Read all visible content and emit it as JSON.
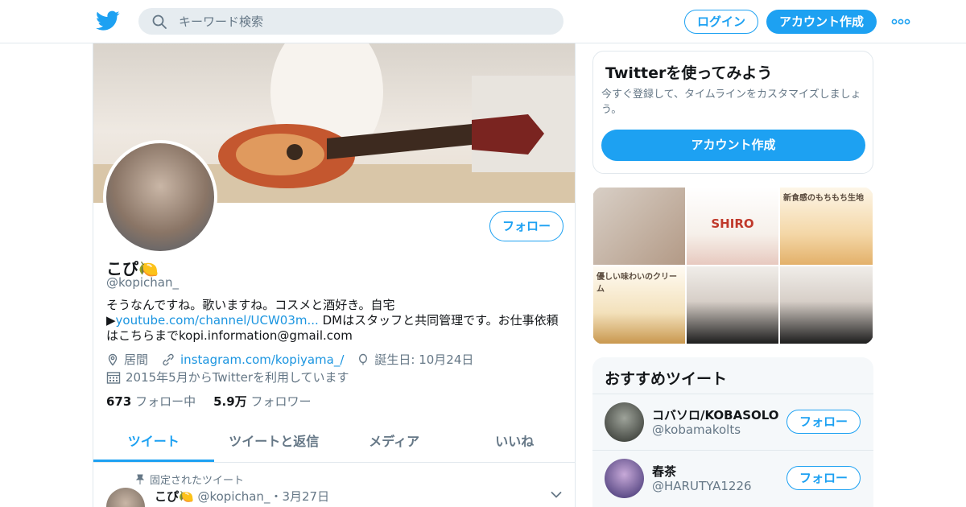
{
  "nav": {
    "search_placeholder": "キーワード検索",
    "login_label": "ログイン",
    "signup_label": "アカウント作成",
    "brand_color": "#1da1f2"
  },
  "profile": {
    "name": "こぴ🍋",
    "handle": "@kopichan_",
    "follow_label": "フォロー",
    "bio_line1": "そうなんですね。歌いますね。コスメと酒好き。自宅",
    "bio_prefix": "▶",
    "bio_link": "youtube.com/channel/UCW03m...",
    "bio_rest": " DMはスタッフと共同管理です。お仕事依頼はこちらまでkopi.information@gmail.com",
    "location": "居間",
    "website": "instagram.com/kopiyama_/",
    "birthday": "誕生日: 10月24日",
    "joined": "2015年5月からTwitterを利用しています",
    "following_count": "673",
    "following_label": "フォロー中",
    "followers_count": "5.9万",
    "followers_label": "フォロワー"
  },
  "tabs": [
    {
      "label": "ツイート",
      "active": true
    },
    {
      "label": "ツイートと返信",
      "active": false
    },
    {
      "label": "メディア",
      "active": false
    },
    {
      "label": "いいね",
      "active": false
    }
  ],
  "pinned_tweet": {
    "pinned_label": "固定されたツイート",
    "author_name": "こぴ🍋",
    "author_handle": "@kopichan_",
    "date": "・3月27日"
  },
  "signup_card": {
    "title": "Twitterを使ってみよう",
    "description": "今すぐ登録して、タイムラインをカスタマイズしましょう。",
    "button_label": "アカウント作成"
  },
  "media_grid": [
    {
      "caption": ""
    },
    {
      "caption": "SHIRO"
    },
    {
      "caption": "新食感のもちもち生地"
    },
    {
      "caption": "優しい味わいのクリーム"
    },
    {
      "caption": ""
    },
    {
      "caption": ""
    }
  ],
  "recommended": {
    "title": "おすすめツイート",
    "users": [
      {
        "name": "コバソロ/KOBASOLO",
        "handle": "@kobamakolts",
        "follow_label": "フォロー"
      },
      {
        "name": "春茶",
        "handle": "@HARUTYA1226",
        "follow_label": "フォロー"
      }
    ]
  }
}
